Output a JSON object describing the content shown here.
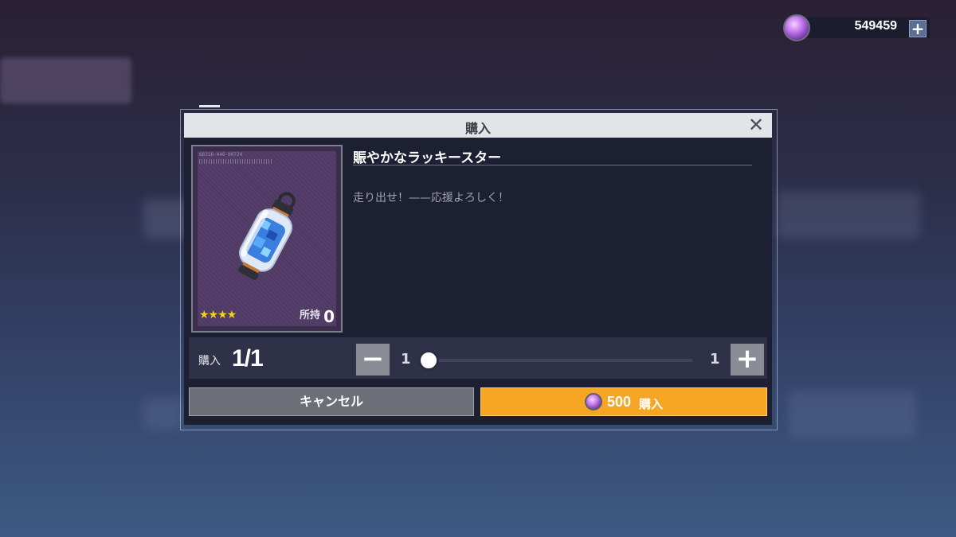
{
  "currency": {
    "amount": "549459",
    "plus": "+",
    "icon": "gem-icon"
  },
  "dialog": {
    "title": "購入",
    "close": "✕",
    "item": {
      "name": "賑やかなラッキースター",
      "description": "走り出せ！——応援よろしく！",
      "code": "66316-446-00724",
      "stars": "★★★★",
      "rarity": 4,
      "owned_label": "所持",
      "owned_count": "0"
    },
    "quantity": {
      "label": "購入",
      "value": "1/1",
      "min": "1",
      "max": "1",
      "minus": "−",
      "plus": "+"
    },
    "cancel_label": "キャンセル",
    "buy": {
      "price": "500",
      "label": "購入"
    }
  },
  "colors": {
    "accent": "#f6a623",
    "panel": "#1d1f33",
    "titlebar": "#e3e4e8"
  }
}
